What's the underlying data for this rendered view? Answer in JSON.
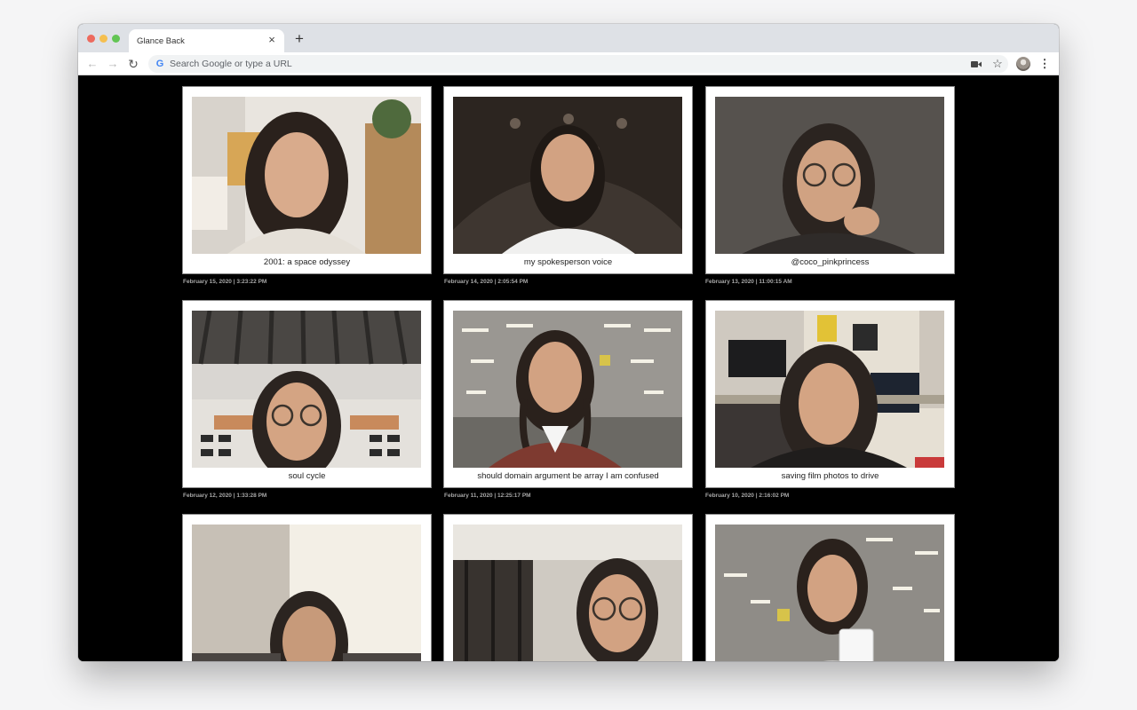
{
  "browser": {
    "tab_title": "Glance Back",
    "tab_close": "×",
    "new_tab": "+",
    "omnibox_placeholder": "Search Google or type a URL",
    "icons": [
      "back-arrow-icon",
      "forward-arrow-icon",
      "reload-icon",
      "google-icon",
      "camera-icon",
      "star-icon",
      "profile-avatar",
      "menu-icon"
    ]
  },
  "gallery": {
    "items": [
      {
        "caption": "2001: a space odyssey",
        "timestamp": "February 15, 2020 | 3:23:22 PM"
      },
      {
        "caption": "my spokesperson voice",
        "timestamp": "February 14, 2020 | 2:05:54 PM"
      },
      {
        "caption": "@coco_pinkprincess",
        "timestamp": "February 13, 2020 | 11:00:15 AM"
      },
      {
        "caption": "soul cycle",
        "timestamp": "February 12, 2020 | 1:33:28 PM"
      },
      {
        "caption": "should domain argument be array I am confused",
        "timestamp": "February 11, 2020 | 12:25:17 PM"
      },
      {
        "caption": "saving film photos to drive",
        "timestamp": "February 10, 2020 | 2:16:02 PM"
      },
      {
        "caption": "",
        "timestamp": ""
      },
      {
        "caption": "",
        "timestamp": ""
      },
      {
        "caption": "",
        "timestamp": ""
      }
    ]
  }
}
